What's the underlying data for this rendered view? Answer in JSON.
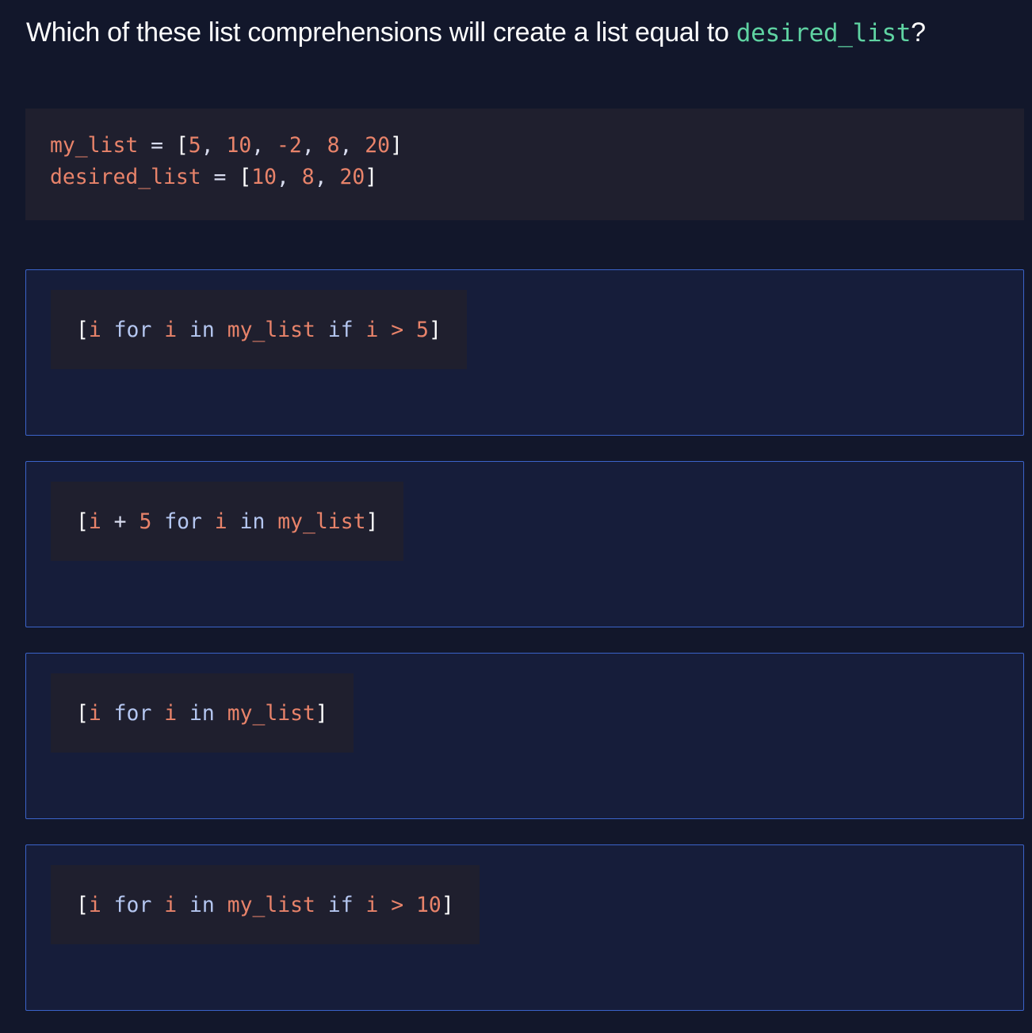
{
  "question": {
    "text": "Which of these list comprehensions will create a list equal to ",
    "code": "desired_list",
    "suffix": "?"
  },
  "context_code": [
    [
      {
        "t": "my_list",
        "c": "v"
      },
      {
        "t": " = ",
        "c": "w"
      },
      {
        "t": "[",
        "c": "p"
      },
      {
        "t": "5",
        "c": "n"
      },
      {
        "t": ", ",
        "c": "w"
      },
      {
        "t": "10",
        "c": "n"
      },
      {
        "t": ", ",
        "c": "w"
      },
      {
        "t": "-2",
        "c": "n"
      },
      {
        "t": ", ",
        "c": "w"
      },
      {
        "t": "8",
        "c": "n"
      },
      {
        "t": ", ",
        "c": "w"
      },
      {
        "t": "20",
        "c": "n"
      },
      {
        "t": "]",
        "c": "p"
      }
    ],
    [
      {
        "t": "desired_list",
        "c": "v"
      },
      {
        "t": " = ",
        "c": "w"
      },
      {
        "t": "[",
        "c": "p"
      },
      {
        "t": "10",
        "c": "n"
      },
      {
        "t": ", ",
        "c": "w"
      },
      {
        "t": "8",
        "c": "n"
      },
      {
        "t": ", ",
        "c": "w"
      },
      {
        "t": "20",
        "c": "n"
      },
      {
        "t": "]",
        "c": "p"
      }
    ]
  ],
  "options": [
    [
      {
        "t": "[",
        "c": "p"
      },
      {
        "t": "i",
        "c": "v"
      },
      {
        "t": " for ",
        "c": "k"
      },
      {
        "t": "i",
        "c": "v"
      },
      {
        "t": " in ",
        "c": "k"
      },
      {
        "t": "my_list",
        "c": "v"
      },
      {
        "t": " if ",
        "c": "k"
      },
      {
        "t": "i",
        "c": "v"
      },
      {
        "t": " > ",
        "c": "o"
      },
      {
        "t": "5",
        "c": "n"
      },
      {
        "t": "]",
        "c": "p"
      }
    ],
    [
      {
        "t": "[",
        "c": "p"
      },
      {
        "t": "i",
        "c": "v"
      },
      {
        "t": " + ",
        "c": "w"
      },
      {
        "t": "5",
        "c": "n"
      },
      {
        "t": " for ",
        "c": "k"
      },
      {
        "t": "i",
        "c": "v"
      },
      {
        "t": " in ",
        "c": "k"
      },
      {
        "t": "my_list",
        "c": "v"
      },
      {
        "t": "]",
        "c": "p"
      }
    ],
    [
      {
        "t": "[",
        "c": "p"
      },
      {
        "t": "i",
        "c": "v"
      },
      {
        "t": " for ",
        "c": "k"
      },
      {
        "t": "i",
        "c": "v"
      },
      {
        "t": " in ",
        "c": "k"
      },
      {
        "t": "my_list",
        "c": "v"
      },
      {
        "t": "]",
        "c": "p"
      }
    ],
    [
      {
        "t": "[",
        "c": "p"
      },
      {
        "t": "i",
        "c": "v"
      },
      {
        "t": " for ",
        "c": "k"
      },
      {
        "t": "i",
        "c": "v"
      },
      {
        "t": " in ",
        "c": "k"
      },
      {
        "t": "my_list",
        "c": "v"
      },
      {
        "t": " if ",
        "c": "k"
      },
      {
        "t": "i",
        "c": "v"
      },
      {
        "t": " > ",
        "c": "o"
      },
      {
        "t": "10",
        "c": "n"
      },
      {
        "t": "]",
        "c": "p"
      }
    ]
  ],
  "colors": {
    "accent_green": "#5fd3a2",
    "border_blue": "#3b63c9",
    "orange": "#e8836a",
    "keyword": "#b4c6f0"
  }
}
